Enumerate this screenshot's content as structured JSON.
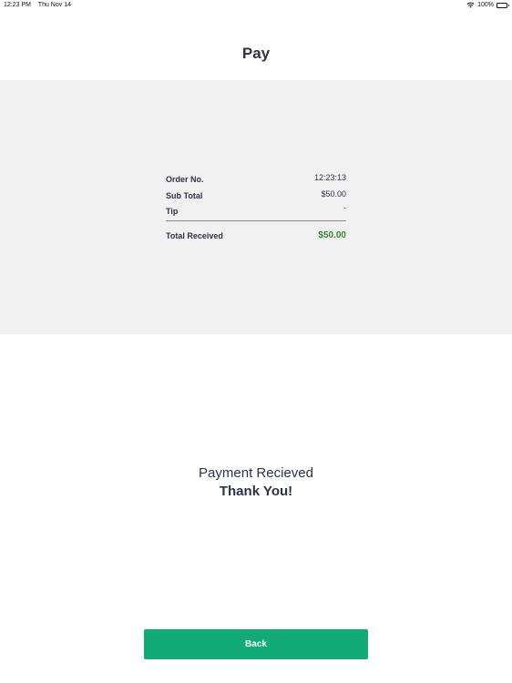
{
  "status_bar": {
    "time": "12:23 PM",
    "date": "Thu Nov 14",
    "battery": "100%"
  },
  "header": {
    "title": "Pay"
  },
  "summary": {
    "order_label": "Order No.",
    "order_value": "12:23:13",
    "subtotal_label": "Sub Total",
    "subtotal_value": "$50.00",
    "tip_label": "Tip",
    "tip_value": "-",
    "total_label": "Total Received",
    "total_value": "$50.00"
  },
  "message": {
    "line1": "Payment Recieved",
    "line2": "Thank You!"
  },
  "footer": {
    "back_label": "Back"
  },
  "colors": {
    "accent": "#12ab77",
    "total_green": "#2f8a2f",
    "panel_bg": "#f1f1f1",
    "text": "#2e3247"
  },
  "icons": [
    "wifi-icon",
    "battery-icon"
  ]
}
